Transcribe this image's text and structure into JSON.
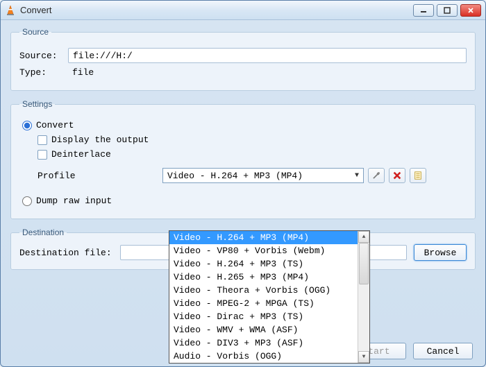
{
  "window": {
    "title": "Convert"
  },
  "source": {
    "legend": "Source",
    "source_label": "Source:",
    "source_value": "file:///H:/",
    "type_label": "Type:",
    "type_value": "file"
  },
  "settings": {
    "legend": "Settings",
    "convert_label": "Convert",
    "display_output_label": "Display the output",
    "deinterlace_label": "Deinterlace",
    "profile_label": "Profile",
    "profile_selected": "Video - H.264 + MP3 (MP4)",
    "profile_options": [
      "Video - H.264 + MP3 (MP4)",
      "Video - VP80 + Vorbis (Webm)",
      "Video - H.264 + MP3 (TS)",
      "Video - H.265 + MP3 (MP4)",
      "Video - Theora + Vorbis (OGG)",
      "Video - MPEG-2 + MPGA (TS)",
      "Video - Dirac + MP3 (TS)",
      "Video - WMV + WMA (ASF)",
      "Video - DIV3 + MP3 (ASF)",
      "Audio - Vorbis (OGG)"
    ],
    "dump_raw_label": "Dump raw input"
  },
  "destination": {
    "legend": "Destination",
    "file_label": "Destination file:",
    "file_value": "",
    "browse_label": "Browse"
  },
  "footer": {
    "start_label": "Start",
    "cancel_label": "Cancel"
  },
  "icons": {
    "edit": "edit-profile-icon",
    "delete": "delete-profile-icon",
    "new": "new-profile-icon"
  }
}
